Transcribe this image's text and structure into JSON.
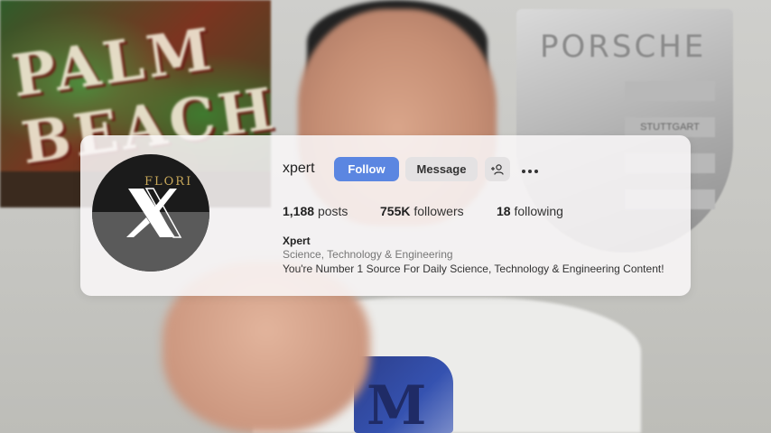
{
  "background": {
    "poster_text": "PALM BEACH",
    "crest_text": "PORSCHE",
    "crest_badge": "STUTTGART",
    "shirt_letter": "M"
  },
  "profile": {
    "avatar_label": "X",
    "avatar_brand": "FLORI",
    "username": "xpert",
    "buttons": {
      "follow_label": "Follow",
      "message_label": "Message",
      "add_user_icon": "person-add-icon",
      "more_icon": "ellipsis-icon"
    },
    "stats": {
      "posts_count": "1,188",
      "posts_label": "posts",
      "followers_count": "755K",
      "followers_label": "followers",
      "following_count": "18",
      "following_label": "following"
    },
    "bio": {
      "name": "Xpert",
      "category": "Science, Technology & Engineering",
      "text": "You're Number 1 Source For Daily Science, Technology & Engineering Content!"
    }
  },
  "colors": {
    "follow_button": "#5b86e1",
    "secondary_button": "#e4e2e3",
    "card_background": "#faf8f9"
  }
}
